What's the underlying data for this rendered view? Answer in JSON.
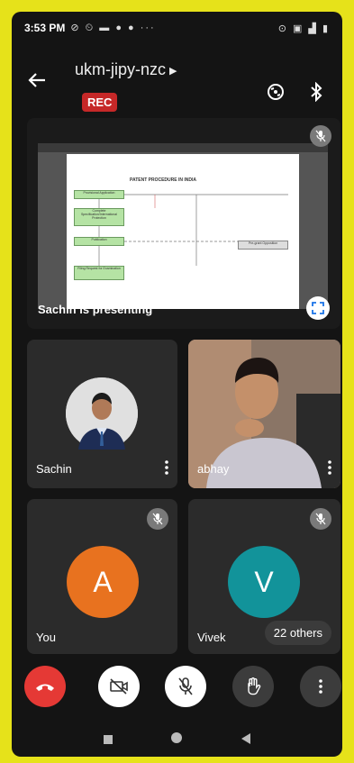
{
  "status": {
    "time": "3:53 PM",
    "left_icons": "⊘ ⏲ ▬ ● ● ···",
    "right_icons": "⊙ ▣ ▟ ▮"
  },
  "header": {
    "meeting_code": "ukm-jipy-nzc",
    "rec_label": "REC"
  },
  "presentation": {
    "label": "Sachin is presenting",
    "slide_title": "PATENT PROCEDURE IN INDIA",
    "slide_boxes": [
      "Provisional Application",
      "Complete Specification/International Protection",
      "Publication",
      "Filing Request for Examination",
      "Pre-grant Opposition"
    ]
  },
  "participants": [
    {
      "name": "Sachin",
      "initial": "",
      "color": "#2b2b2b"
    },
    {
      "name": "abhay",
      "initial": "",
      "color": "#7b6a5e"
    },
    {
      "name": "You",
      "initial": "A",
      "color": "#e8721f"
    },
    {
      "name": "Vivek",
      "initial": "V",
      "color": "#12939a"
    }
  ],
  "others_label": "22 others",
  "controls": {
    "end_call_color": "#e53935"
  }
}
